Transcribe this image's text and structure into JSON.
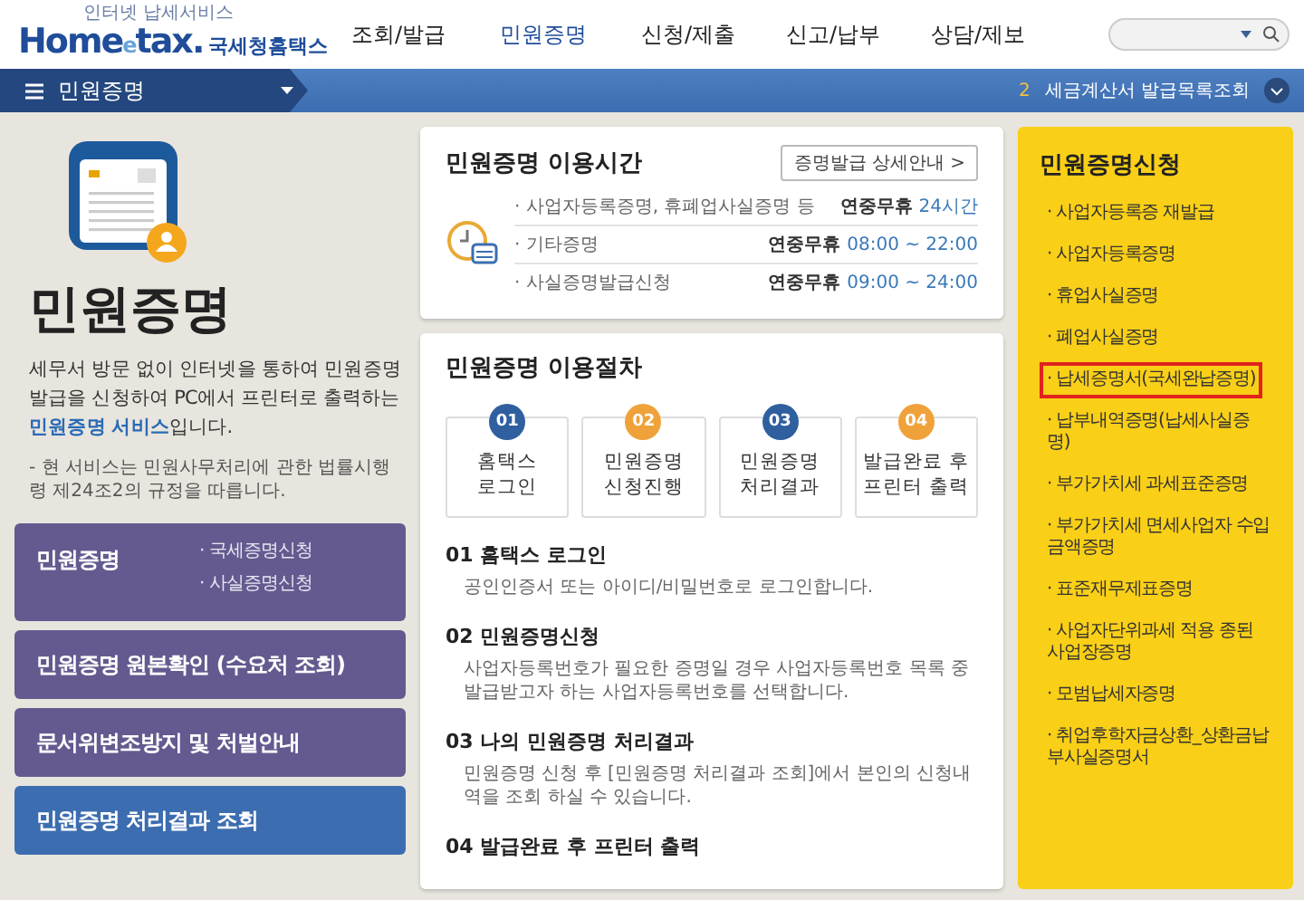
{
  "header": {
    "logo": {
      "tagline": "인터넷 납세서비스",
      "brand_main": "Home",
      "brand_e": "e",
      "brand_tail": "tax.",
      "name": "국세청홈택스"
    },
    "nav": [
      {
        "label": "조회/발급",
        "selected": false
      },
      {
        "label": "민원증명",
        "selected": true
      },
      {
        "label": "신청/제출",
        "selected": false
      },
      {
        "label": "신고/납부",
        "selected": false
      },
      {
        "label": "상담/제보",
        "selected": false
      }
    ],
    "search": {
      "kind": "dropdown"
    }
  },
  "menu_bar": {
    "title": "민원증명",
    "notice_number": "2",
    "notice": "세금계산서 발급목록조회"
  },
  "intro": {
    "title": "민원증명",
    "description": "세무서 방문 없이 인터넷을 통하여 민원증명발급을 신청하여 PC에서 프린터로 출력하는 **민원증명 서비스**입니다.",
    "note": "- 현 서비스는 민원사무처리에 관한 법률시행령 제24조2의 규정을 따릅니다."
  },
  "service_menu": [
    {
      "label": "민원증명",
      "links": [
        "· 국세증명신청",
        "· 사실증명신청"
      ],
      "selected": false
    },
    {
      "label": "민원증명 원본확인 (수요처 조회)",
      "selected": false
    },
    {
      "label": "문서위변조방지 및 처벌안내",
      "selected": false
    },
    {
      "label": "민원증명 처리결과 조회",
      "selected": true
    }
  ],
  "hours": {
    "title": "민원증명 이용시간",
    "detail_button": "증명발급 상세안내 >",
    "rows": [
      {
        "label": "· 사업자등록증명, 휴폐업사실증명 등",
        "prefix": "연중무휴",
        "time": "24시간"
      },
      {
        "label": "· 기타증명",
        "prefix": "연중무휴",
        "time": "08:00 ~ 22:00"
      },
      {
        "label": "· 사실증명발급신청",
        "prefix": "연중무휴",
        "time": "09:00 ~ 24:00"
      }
    ]
  },
  "procedure": {
    "title": "민원증명 이용절차",
    "steps": [
      {
        "number": "01",
        "label": "홈택스\n로그인",
        "color": "#2f5f9e"
      },
      {
        "number": "02",
        "label": "민원증명\n신청진행",
        "color": "#f0a23a"
      },
      {
        "number": "03",
        "label": "민원증명\n처리결과",
        "color": "#2f5f9e"
      },
      {
        "number": "04",
        "label": "발급완료 후\n프린터 출력",
        "color": "#f0a23a"
      }
    ],
    "details": [
      {
        "heading": "01 홈택스 로그인",
        "text": "공인인증서 또는 아이디/비밀번호로 로그인합니다."
      },
      {
        "heading": "02 민원증명신청",
        "text": "사업자등록번호가 필요한 증명일 경우 사업자등록번호 목록 중 발급받고자 하는 사업자등록번호를 선택합니다."
      },
      {
        "heading": "03 나의 민원증명 처리결과",
        "text": "민원증명 신청 후 [민원증명 처리결과 조회]에서 본인의 신청내역을 조회 하실 수 있습니다."
      },
      {
        "heading": "04 발급완료 후 프린터 출력"
      }
    ]
  },
  "apply": {
    "title": "민원증명신청",
    "items": [
      {
        "label": "· 사업자등록증 재발급",
        "highlighted": false
      },
      {
        "label": "· 사업자등록증명",
        "highlighted": false
      },
      {
        "label": "· 휴업사실증명",
        "highlighted": false
      },
      {
        "label": "· 폐업사실증명",
        "highlighted": false
      },
      {
        "label": "· 납세증명서(국세완납증명)",
        "highlighted": true
      },
      {
        "label": "· 납부내역증명(납세사실증명)",
        "highlighted": false
      },
      {
        "label": "· 부가가치세 과세표준증명",
        "highlighted": false
      },
      {
        "label": "· 부가가치세 면세사업자 수입금액증명",
        "highlighted": false
      },
      {
        "label": "· 표준재무제표증명",
        "highlighted": false
      },
      {
        "label": "· 사업자단위과세 적용 종된 사업장증명",
        "highlighted": false
      },
      {
        "label": "· 모범납세자증명",
        "highlighted": false
      },
      {
        "label": "· 취업후학자금상환_상환금납부사실증명서",
        "highlighted": false
      }
    ]
  }
}
